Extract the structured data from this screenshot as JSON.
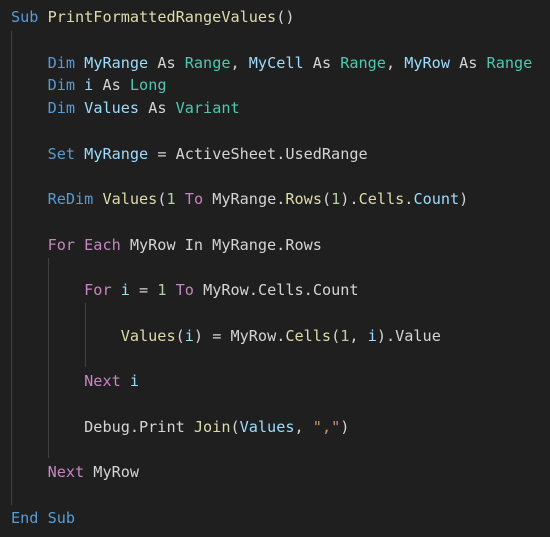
{
  "editor": {
    "theme_colors": {
      "background": "#1f1f1f",
      "keyword": "#569cd6",
      "control": "#c586c0",
      "type": "#4ec9b0",
      "variable": "#9cdcfe",
      "function": "#dcdcaa",
      "number": "#b5cea8",
      "string": "#ce9178",
      "plain": "#d4d4d4"
    },
    "lines": [
      {
        "tokens": [
          {
            "t": "Sub",
            "c": "kw"
          },
          {
            "t": " ",
            "c": "pl"
          },
          {
            "t": "PrintFormattedRangeValues",
            "c": "fn"
          },
          {
            "t": "()",
            "c": "pl"
          }
        ]
      },
      {
        "tokens": []
      },
      {
        "tokens": [
          {
            "t": "    ",
            "c": "pl"
          },
          {
            "t": "Dim",
            "c": "kw"
          },
          {
            "t": " ",
            "c": "pl"
          },
          {
            "t": "MyRange",
            "c": "var"
          },
          {
            "t": " As ",
            "c": "pl"
          },
          {
            "t": "Range",
            "c": "typ"
          },
          {
            "t": ", ",
            "c": "pl"
          },
          {
            "t": "MyCell",
            "c": "var"
          },
          {
            "t": " As ",
            "c": "pl"
          },
          {
            "t": "Range",
            "c": "typ"
          },
          {
            "t": ", ",
            "c": "pl"
          },
          {
            "t": "MyRow",
            "c": "var"
          },
          {
            "t": " As ",
            "c": "pl"
          },
          {
            "t": "Range",
            "c": "typ"
          }
        ]
      },
      {
        "tokens": [
          {
            "t": "    ",
            "c": "pl"
          },
          {
            "t": "Dim",
            "c": "kw"
          },
          {
            "t": " ",
            "c": "pl"
          },
          {
            "t": "i",
            "c": "var"
          },
          {
            "t": " As ",
            "c": "pl"
          },
          {
            "t": "Long",
            "c": "typ"
          }
        ]
      },
      {
        "tokens": [
          {
            "t": "    ",
            "c": "pl"
          },
          {
            "t": "Dim",
            "c": "kw"
          },
          {
            "t": " ",
            "c": "pl"
          },
          {
            "t": "Values",
            "c": "var"
          },
          {
            "t": " As ",
            "c": "pl"
          },
          {
            "t": "Variant",
            "c": "typ"
          }
        ]
      },
      {
        "tokens": []
      },
      {
        "tokens": [
          {
            "t": "    ",
            "c": "pl"
          },
          {
            "t": "Set",
            "c": "kw"
          },
          {
            "t": " ",
            "c": "pl"
          },
          {
            "t": "MyRange",
            "c": "var"
          },
          {
            "t": " = ActiveSheet.UsedRange",
            "c": "pl"
          }
        ]
      },
      {
        "tokens": []
      },
      {
        "tokens": [
          {
            "t": "    ",
            "c": "pl"
          },
          {
            "t": "ReDim",
            "c": "kw"
          },
          {
            "t": " ",
            "c": "pl"
          },
          {
            "t": "Values",
            "c": "fn"
          },
          {
            "t": "(",
            "c": "pl"
          },
          {
            "t": "1",
            "c": "num"
          },
          {
            "t": " ",
            "c": "pl"
          },
          {
            "t": "To",
            "c": "ctl"
          },
          {
            "t": " MyRange.",
            "c": "pl"
          },
          {
            "t": "Rows",
            "c": "fn"
          },
          {
            "t": "(",
            "c": "pl"
          },
          {
            "t": "1",
            "c": "num"
          },
          {
            "t": ").",
            "c": "pl"
          },
          {
            "t": "Cells",
            "c": "fn"
          },
          {
            "t": ".",
            "c": "pl"
          },
          {
            "t": "Count",
            "c": "var"
          },
          {
            "t": ")",
            "c": "pl"
          }
        ]
      },
      {
        "tokens": []
      },
      {
        "tokens": [
          {
            "t": "    ",
            "c": "pl"
          },
          {
            "t": "For Each",
            "c": "ctl"
          },
          {
            "t": " MyRow In MyRange.Rows",
            "c": "pl"
          }
        ]
      },
      {
        "tokens": []
      },
      {
        "tokens": [
          {
            "t": "        ",
            "c": "pl"
          },
          {
            "t": "For",
            "c": "ctl"
          },
          {
            "t": " ",
            "c": "pl"
          },
          {
            "t": "i",
            "c": "var"
          },
          {
            "t": " = ",
            "c": "pl"
          },
          {
            "t": "1",
            "c": "num"
          },
          {
            "t": " ",
            "c": "pl"
          },
          {
            "t": "To",
            "c": "ctl"
          },
          {
            "t": " MyRow.Cells.Count",
            "c": "pl"
          }
        ]
      },
      {
        "tokens": []
      },
      {
        "tokens": [
          {
            "t": "            ",
            "c": "pl"
          },
          {
            "t": "Values",
            "c": "fn"
          },
          {
            "t": "(",
            "c": "pl"
          },
          {
            "t": "i",
            "c": "var"
          },
          {
            "t": ") = MyRow.",
            "c": "pl"
          },
          {
            "t": "Cells",
            "c": "fn"
          },
          {
            "t": "(",
            "c": "pl"
          },
          {
            "t": "1",
            "c": "num"
          },
          {
            "t": ", ",
            "c": "pl"
          },
          {
            "t": "i",
            "c": "var"
          },
          {
            "t": ").Value",
            "c": "pl"
          }
        ]
      },
      {
        "tokens": []
      },
      {
        "tokens": [
          {
            "t": "        ",
            "c": "pl"
          },
          {
            "t": "Next",
            "c": "ctl"
          },
          {
            "t": " ",
            "c": "pl"
          },
          {
            "t": "i",
            "c": "var"
          }
        ]
      },
      {
        "tokens": []
      },
      {
        "tokens": [
          {
            "t": "        ",
            "c": "pl"
          },
          {
            "t": "Debug.Print ",
            "c": "pl"
          },
          {
            "t": "Join",
            "c": "fn"
          },
          {
            "t": "(",
            "c": "pl"
          },
          {
            "t": "Values",
            "c": "var"
          },
          {
            "t": ", ",
            "c": "pl"
          },
          {
            "t": "\",\"",
            "c": "str"
          },
          {
            "t": ")",
            "c": "pl"
          }
        ]
      },
      {
        "tokens": []
      },
      {
        "tokens": [
          {
            "t": "    ",
            "c": "pl"
          },
          {
            "t": "Next",
            "c": "ctl"
          },
          {
            "t": " MyRow",
            "c": "pl"
          }
        ]
      },
      {
        "tokens": []
      },
      {
        "tokens": [
          {
            "t": "End Sub",
            "c": "kw"
          }
        ]
      }
    ]
  }
}
